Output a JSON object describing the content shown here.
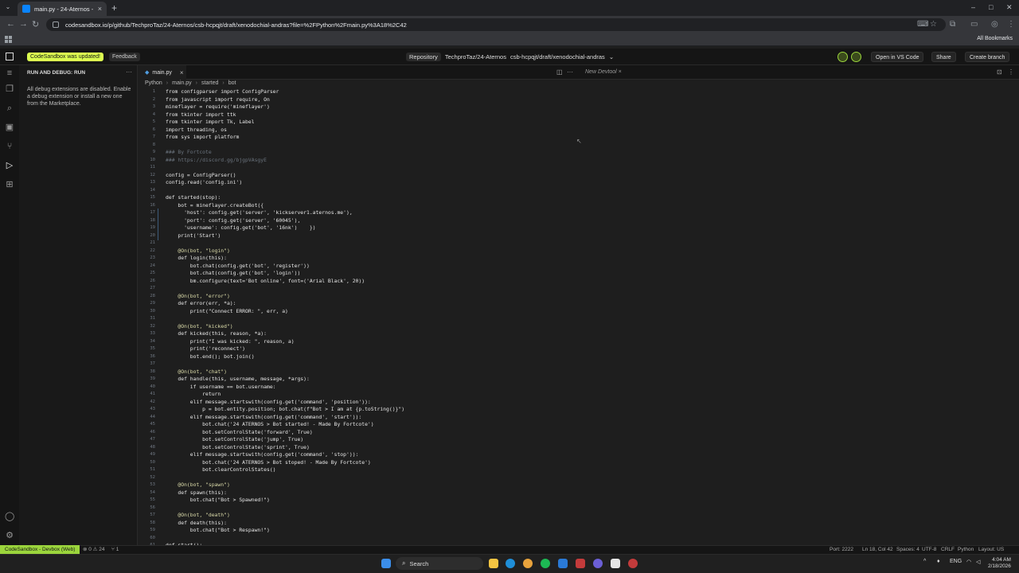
{
  "browser": {
    "tab_title": "main.py - 24-Aternos - CodeSa",
    "tab_close": "×",
    "new_tab": "+",
    "tab_menu": "⌄",
    "url": "codesandbox.io/p/github/TechproTaz/24-Aternos/csb-hcpqjt/draft/xenodochial-andras?file=%2FPython%2Fmain.py%3A18%2C42",
    "back": "←",
    "forward": "→",
    "reload": "↻",
    "all_bookmarks": "All Bookmarks",
    "minimize": "–",
    "maximize": "□",
    "close": "✕"
  },
  "header": {
    "update_badge": "CodeSandbox was updated!",
    "feedback": "Feedback",
    "repository_label": "Repository",
    "repo_path": "TechproTaz/24-Aternos",
    "branch_path": "csb-hcpqjt/draft/xenodochial-andras",
    "open_in_vscode": "Open in VS Code",
    "share": "Share",
    "create_branch": "Create branch",
    "accent_color": "#dcff50",
    "presence_color": "#9bd53c"
  },
  "sidebar": {
    "title": "RUN AND DEBUG: RUN",
    "more": "···",
    "message": "All debug extensions are disabled. Enable a debug extension or install a new one from the Marketplace."
  },
  "editor": {
    "tab_name": "main.py",
    "tab_close": "×",
    "devtool_tab": "New Devtool",
    "breadcrumb": [
      "Python",
      "main.py",
      "started",
      "bot"
    ],
    "lines": [
      "from configparser import ConfigParser",
      "from javascript import require, On",
      "mineflayer = require('mineflayer')",
      "from tkinter import ttk",
      "from tkinter import Tk, Label",
      "import threading, os",
      "from sys import platform",
      "",
      "### By Fortcote",
      "### https://discord.gg/bjgpVAsgyE",
      "",
      "config = ConfigParser()",
      "config.read('config.ini')",
      "",
      "def started(stop):",
      "    bot = mineflayer.createBot({",
      "      'host': config.get('server', 'kickserver1.aternos.me'),",
      "      'port': config.get('server', '60045'),",
      "      'username': config.get('bot', '16nk')    })",
      "    print('Start')",
      "",
      "    @On(bot, \"login\")",
      "    def login(this):",
      "        bot.chat(config.get('bot', 'register'))",
      "        bot.chat(config.get('bot', 'login'))",
      "        bm.configure(text='Bot online', font=('Arial Black', 20))",
      "",
      "    @On(bot, \"error\")",
      "    def error(err, *a):",
      "        print(\"Connect ERROR: \", err, a)",
      "",
      "    @On(bot, \"kicked\")",
      "    def kicked(this, reason, *a):",
      "        print(\"I was kicked: \", reason, a)",
      "        print('reconnect')",
      "        bot.end(); bot.join()",
      "",
      "    @On(bot, \"chat\")",
      "    def handle(this, username, message, *args):",
      "        if username == bot.username:",
      "            return",
      "        elif message.startswith(config.get('command', 'position')):",
      "            p = bot.entity.position; bot.chat(f\"Bot > I am at {p.toString()}\")",
      "        elif message.startswith(config.get('command', 'start')):",
      "            bot.chat('24 ATERNOS > Bot started! - Made By Fortcote')",
      "            bot.setControlState('forward', True)",
      "            bot.setControlState('jump', True)",
      "            bot.setControlState('sprint', True)",
      "        elif message.startswith(config.get('command', 'stop')):",
      "            bot.chat('24 ATERNOS > Bot stoped! - Made By Fortcote')",
      "            bot.clearControlStates()",
      "",
      "    @On(bot, \"spawn\")",
      "    def spawn(this):",
      "        bot.chat(\"Bot > Spawned!\")",
      "",
      "    @On(bot, \"death\")",
      "    def death(this):",
      "        bot.chat(\"Bot > Respawn!\")",
      "",
      "def start():"
    ]
  },
  "statusbar": {
    "remote": "CodeSandbox - Devbox (Web)",
    "problems": "⊗ 0 ⚠ 24",
    "ports": "1",
    "port": "Port: 2222",
    "position": "Ln 18, Col 42",
    "spaces": "Spaces: 4",
    "encoding": "UTF-8",
    "eol": "CRLF",
    "language": "Python",
    "layout": "Layout: US"
  },
  "taskbar": {
    "search": "Search",
    "language": "ENG",
    "time": "4:04 AM",
    "date": "2/18/2026"
  }
}
